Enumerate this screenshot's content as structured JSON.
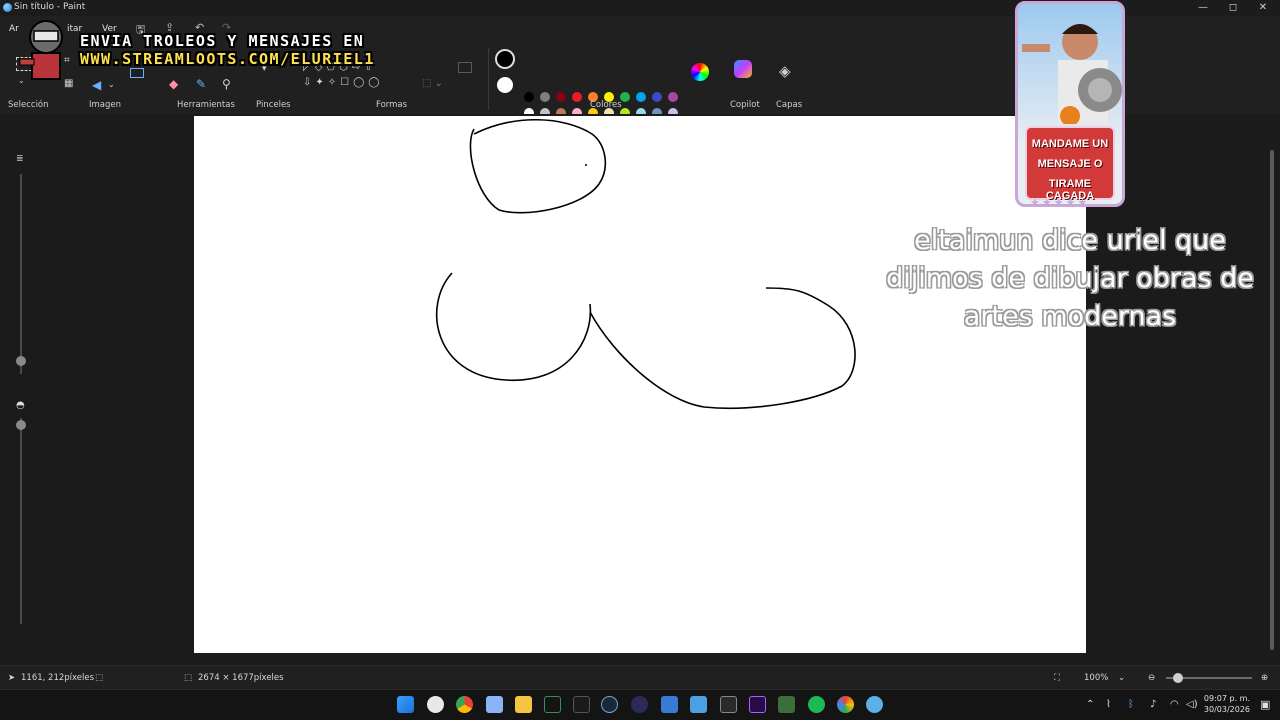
{
  "window": {
    "title": "Sin título - Paint",
    "controls": {
      "minimize": "—",
      "maximize": "◻",
      "close": "✕"
    }
  },
  "menu": {
    "items": [
      "Ar",
      "Editar",
      "Ver"
    ],
    "edit_partial": "itar"
  },
  "ribbon": {
    "groups": {
      "seleccion": "Selección",
      "imagen": "Imagen",
      "herramientas": "Herramientas",
      "pinceles": "Pinceles",
      "formas": "Formas",
      "colores": "Colores",
      "copilot": "Copilot",
      "capas": "Capas"
    },
    "palette_row1": [
      "#000000",
      "#7f7f7f",
      "#880015",
      "#ed1c24",
      "#ff7f27",
      "#fff200",
      "#22b14c",
      "#00a2e8",
      "#3f48cc",
      "#a349a4"
    ],
    "palette_row2": [
      "#ffffff",
      "#c3c3c3",
      "#b97a57",
      "#ffaec9",
      "#ffc90e",
      "#efe4b0",
      "#b5e61d",
      "#99d9ea",
      "#7092be",
      "#c8bfe7"
    ],
    "empty_swatches": 10,
    "primary_color": "#000000",
    "secondary_color": "#ffffff"
  },
  "overlay": {
    "banner_line1": "ENVIA TROLEOS Y MENSAJES EN",
    "banner_line2": "WWW.STREAMLOOTS.COM/ELURIEL1",
    "webcam_msg": [
      "MANDAME UN",
      "MENSAJE O",
      "TIRAME CAGADA"
    ],
    "chat": [
      "eltaimun dice uriel que",
      "dijimos de dibujar obras de",
      "artes modernas"
    ]
  },
  "status": {
    "cursor_pos": "1161, 212píxeles",
    "canvas_size": "2674 × 1677píxeles",
    "zoom": "100%"
  },
  "taskbar": {
    "time": "09:07 p. m.",
    "date": "30/03/2026"
  }
}
